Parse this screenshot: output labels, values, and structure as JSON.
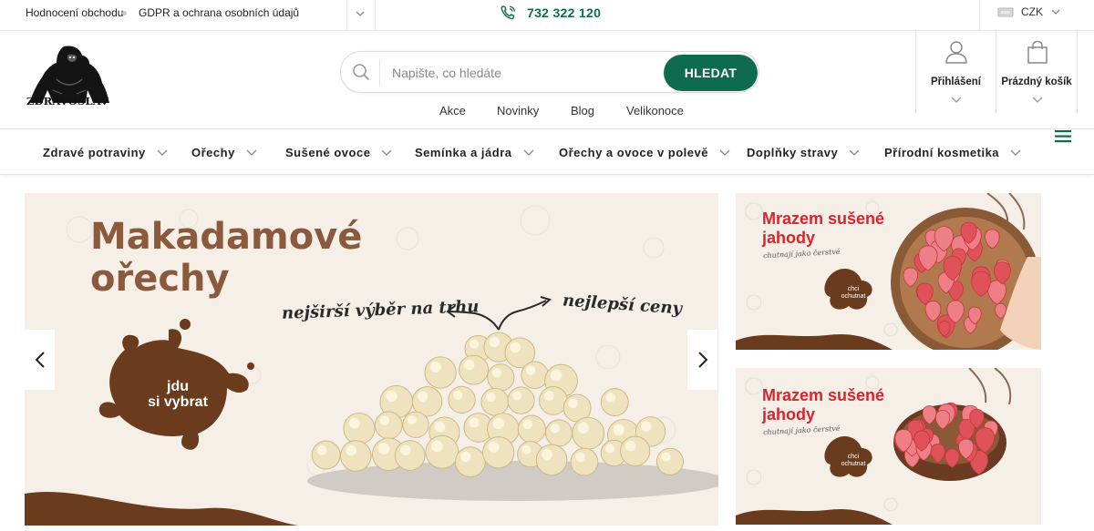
{
  "topbar": {
    "links": [
      "Hodnocení obchodu",
      "GDPR a ochrana osobních údajů"
    ],
    "phone": "732 322 120",
    "currency": "CZK"
  },
  "header": {
    "logo_text": "ZDRAVOSLAV",
    "search_placeholder": "Napište, co hledáte",
    "search_button": "HLEDAT",
    "sublinks": [
      "Akce",
      "Novinky",
      "Blog",
      "Velikonoce"
    ],
    "login_label": "Přihlášení",
    "cart_label": "Prázdný košík"
  },
  "nav": {
    "items": [
      "Zdravé potraviny",
      "Ořechy",
      "Sušené ovoce",
      "Semínka a jádra",
      "Ořechy a ovoce v polevě",
      "Doplňky stravy",
      "Přírodní kosmetika"
    ]
  },
  "hero": {
    "title_line1": "Makadamové",
    "title_line2": "ořechy",
    "left_note": "nejširší výběr na trhu",
    "right_note": "nejlepší ceny",
    "cta_line1": "jdu",
    "cta_line2": "si vybrat"
  },
  "side_banners": [
    {
      "title_line1": "Mrazem sušené",
      "title_line2": "jahody",
      "tagline": "chutnají jako čerstvé",
      "cta_line1": "chci",
      "cta_line2": "ochutnat"
    },
    {
      "title_line1": "Mrazem sušené",
      "title_line2": "jahody",
      "tagline": "chutnají jako čerstvé",
      "cta_line1": "chci",
      "cta_line2": "ochutnat"
    }
  ],
  "colors": {
    "brand_green": "#0f6b4e",
    "chocolate": "#6b3b1e",
    "strawberry_red": "#d8252c",
    "banner_bg": "#f6efe8"
  }
}
